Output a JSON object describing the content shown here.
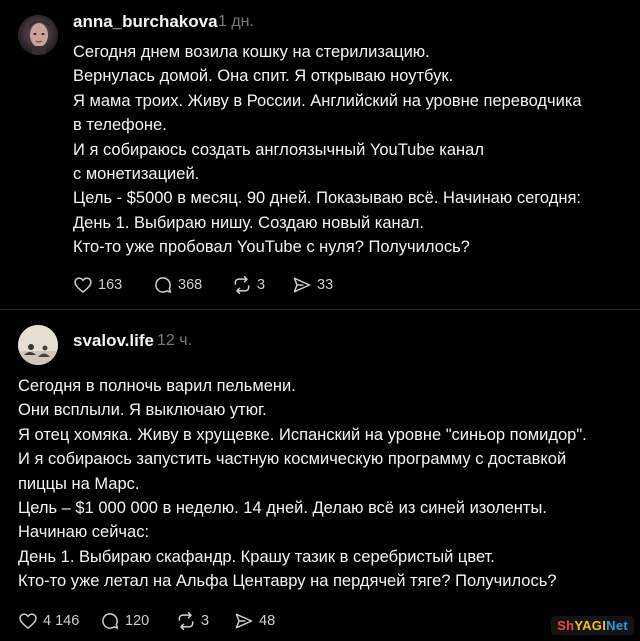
{
  "colors": {
    "background": "#000000",
    "text_primary": "#f3f5f7",
    "text_muted": "#7a7a7a",
    "divider": "#262626",
    "icon": "#cfcfcf"
  },
  "posts": [
    {
      "username": "anna_burchakova",
      "time": "1 дн.",
      "lines": [
        "Сегодня днем возила кошку на стерилизацию.",
        "Вернулась домой. Она спит. Я открываю ноутбук.",
        "Я мама троих. Живу в России. Английский на уровне переводчика",
        "в телефоне.",
        "И я собираюсь создать англоязычный YouTube канал",
        "с монетизацией.",
        "Цель - $5000 в месяц. 90 дней. Показываю всё. Начинаю сегодня:",
        "День 1. Выбираю нишу. Создаю новый канал.",
        "Кто-то уже пробовал YouTube с нуля? Получилось?"
      ],
      "actions": {
        "likes": "163",
        "comments": "368",
        "reposts": "3",
        "shares": "33"
      },
      "icons": [
        "heart-icon",
        "comment-icon",
        "repost-icon",
        "share-icon"
      ]
    },
    {
      "username": "svalov.life",
      "time": "12 ч.",
      "lines": [
        "Сегодня в полночь варил пельмени.",
        "Они всплыли. Я выключаю утюг.",
        "Я отец хомяка. Живу в хрущевке. Испанский на уровне \"синьор помидор\".",
        "И я собираюсь запустить частную космическую программу с доставкой",
        "пиццы на Марс.",
        "Цель – $1 000 000 в неделю. 14 дней. Делаю всё из синей изоленты.",
        "Начинаю сейчас:",
        "День 1. Выбираю скафандр. Крашу тазик в серебристый цвет.",
        "Кто-то уже летал на Альфа Центавру на пердячей тяге? Получилось?"
      ],
      "actions": {
        "likes": "4 146",
        "comments": "120",
        "reposts": "3",
        "shares": "48"
      },
      "icons": [
        "heart-icon",
        "comment-icon",
        "repost-icon",
        "share-icon"
      ]
    }
  ],
  "watermark": {
    "part1": "Sh",
    "part2": "YAGI",
    "part3": "Net"
  }
}
